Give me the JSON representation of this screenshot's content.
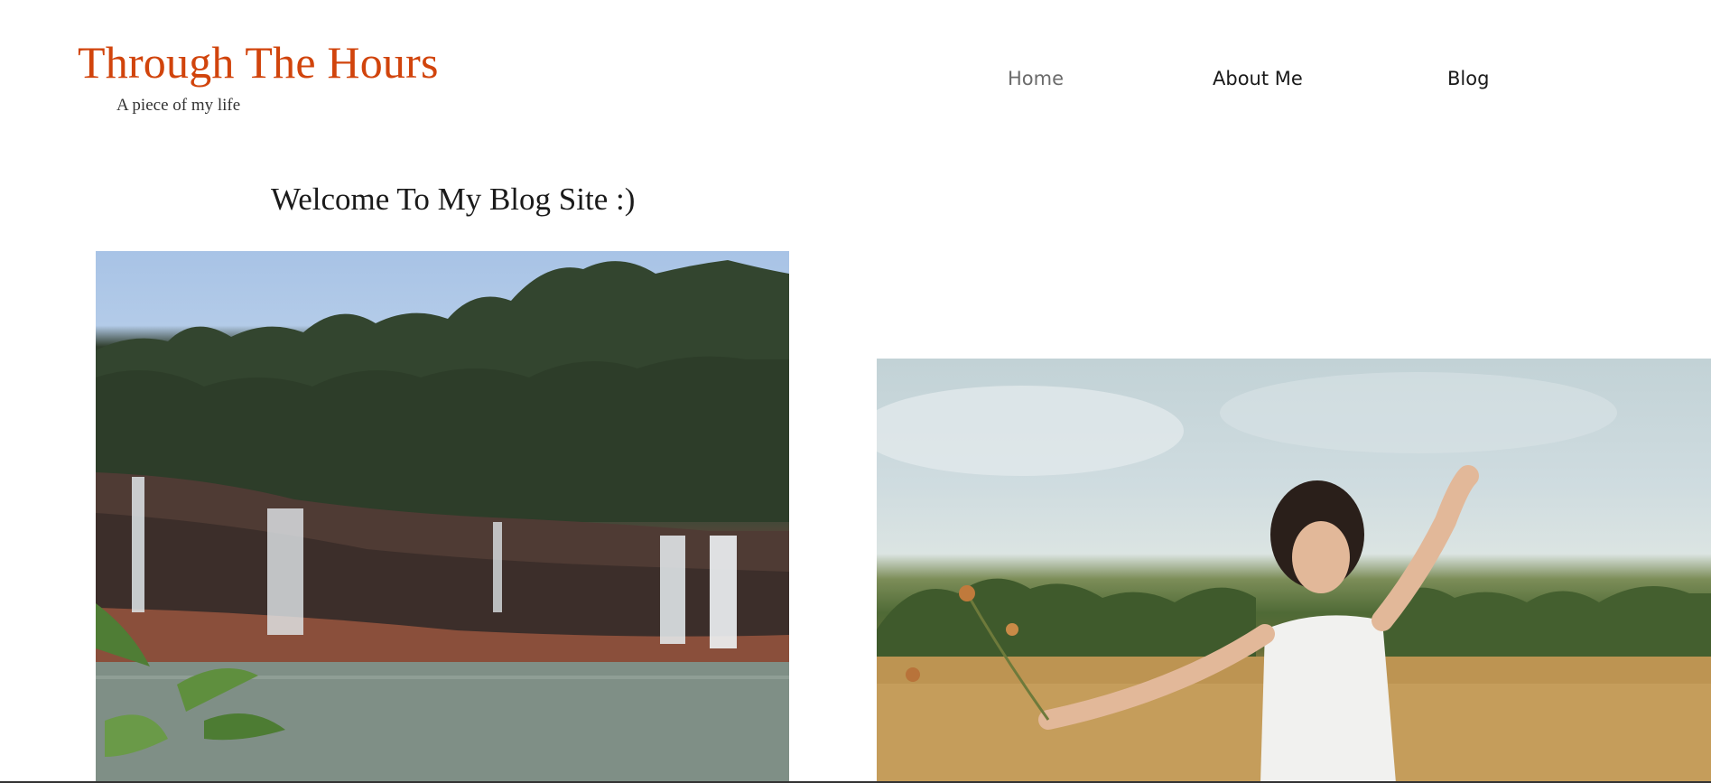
{
  "site": {
    "title": "Through The Hours",
    "tagline": "A piece of my life",
    "brand_color": "#d1440c"
  },
  "nav": {
    "items": [
      {
        "label": "Home",
        "active": true
      },
      {
        "label": "About Me",
        "active": false
      },
      {
        "label": "Blog",
        "active": false
      }
    ]
  },
  "main": {
    "welcome_heading": "Welcome To My Blog Site :)",
    "images": [
      {
        "name": "waterfall-photo"
      },
      {
        "name": "woman-in-field-photo"
      }
    ]
  }
}
